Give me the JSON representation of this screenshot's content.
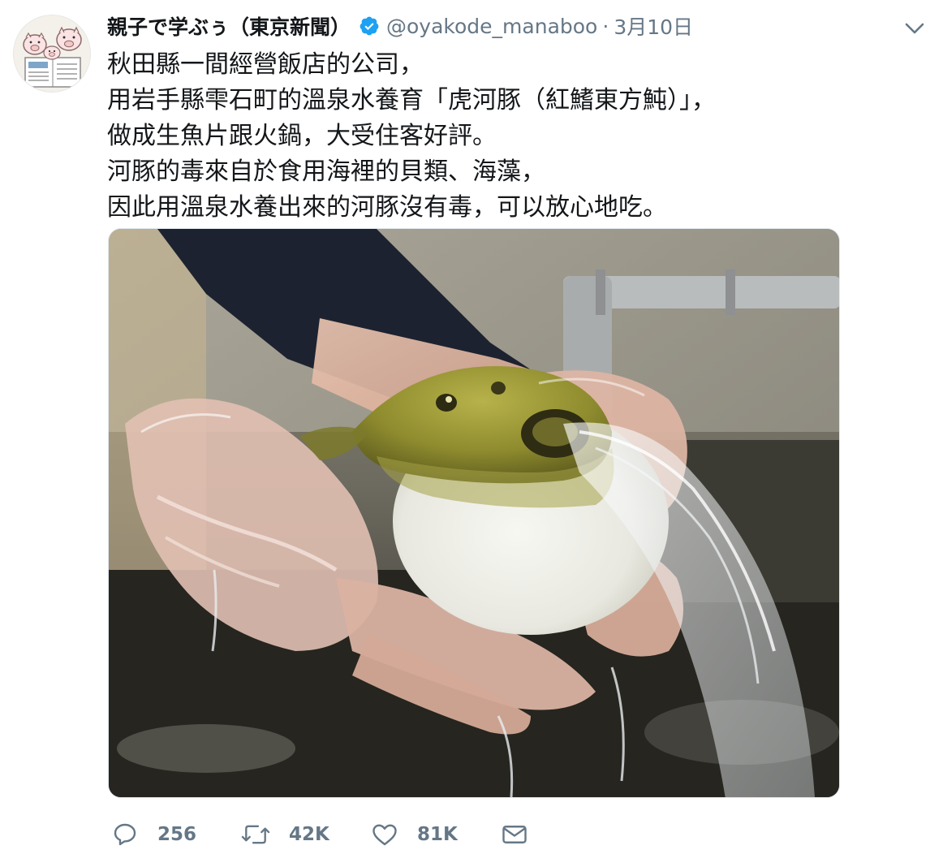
{
  "tweet": {
    "display_name": "親子で学ぶぅ（東京新聞）",
    "handle": "@oyakode_manaboo",
    "separator": "·",
    "date": "3月10日",
    "verified": true,
    "text_lines": [
      "秋田縣一間經營飯店的公司，",
      "用岩手縣雫石町的溫泉水養育「虎河豚（紅鰭東方魨）」，",
      "做成生魚片跟火鍋，大受住客好評。",
      "河豚的毒來自於食用海裡的貝類、海藻，",
      "因此用溫泉水養出來的河豚沒有毒，可以放心地吃。"
    ],
    "actions": {
      "reply_count": "256",
      "retweet_count": "42K",
      "like_count": "81K"
    }
  },
  "icons": {
    "verified": "verified-badge-icon",
    "menu": "chevron-down-icon",
    "reply": "reply-icon",
    "retweet": "retweet-icon",
    "like": "heart-icon",
    "dm": "envelope-icon"
  },
  "colors": {
    "text_primary": "#14171a",
    "text_secondary": "#657786",
    "verified_blue": "#1da1f2",
    "border": "#e1e8ed"
  }
}
